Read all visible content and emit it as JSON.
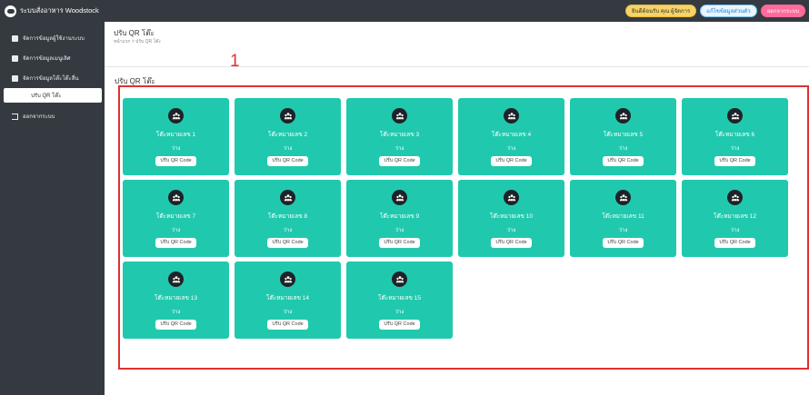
{
  "brand": {
    "name": "ระบบสั่งอาหาร Woodstock"
  },
  "top_actions": [
    {
      "label": "ยินดีต้อนรับ คุณ ผู้จัดการ",
      "style": "green"
    },
    {
      "label": "แก้ไขข้อมูลส่วนตัว",
      "style": "blue"
    },
    {
      "label": "ออกจากระบบ",
      "style": "pink"
    }
  ],
  "sidebar": {
    "items": [
      {
        "label": "จัดการข้อมูลผู้ใช้งานระบบ",
        "icon": "users-icon"
      },
      {
        "label": "จัดการข้อมูลเมนูเลิศ",
        "icon": "document-icon"
      },
      {
        "label": "จัดการข้อมูลโต๊ะโต๊ะลื่น",
        "icon": "table-icon"
      }
    ],
    "sub_item": "ปรับ QR โต๊ะ",
    "logout": "ออกจากระบบ"
  },
  "header": {
    "title": "ปรับ QR โต๊ะ",
    "breadcrumb": "หน้าแรก > ปรับ QR โต๊ะ"
  },
  "annotation": "1",
  "section_title": "ปรับ QR โต๊ะ",
  "tables": [
    {
      "name": "โต๊ะหมายเลข 1",
      "status": "ว่าง",
      "button": "ปรับ QR Code"
    },
    {
      "name": "โต๊ะหมายเลข 2",
      "status": "ว่าง",
      "button": "ปรับ QR Code"
    },
    {
      "name": "โต๊ะหมายเลข 3",
      "status": "ว่าง",
      "button": "ปรับ QR Code"
    },
    {
      "name": "โต๊ะหมายเลข 4",
      "status": "ว่าง",
      "button": "ปรับ QR Code"
    },
    {
      "name": "โต๊ะหมายเลข 5",
      "status": "ว่าง",
      "button": "ปรับ QR Code"
    },
    {
      "name": "โต๊ะหมายเลข 6",
      "status": "ว่าง",
      "button": "ปรับ QR Code"
    },
    {
      "name": "โต๊ะหมายเลข 7",
      "status": "ว่าง",
      "button": "ปรับ QR Code"
    },
    {
      "name": "โต๊ะหมายเลข 8",
      "status": "ว่าง",
      "button": "ปรับ QR Code"
    },
    {
      "name": "โต๊ะหมายเลข 9",
      "status": "ว่าง",
      "button": "ปรับ QR Code"
    },
    {
      "name": "โต๊ะหมายเลข 10",
      "status": "ว่าง",
      "button": "ปรับ QR Code"
    },
    {
      "name": "โต๊ะหมายเลข 11",
      "status": "ว่าง",
      "button": "ปรับ QR Code"
    },
    {
      "name": "โต๊ะหมายเลข 12",
      "status": "ว่าง",
      "button": "ปรับ QR Code"
    },
    {
      "name": "โต๊ะหมายเลข 13",
      "status": "ว่าง",
      "button": "ปรับ QR Code"
    },
    {
      "name": "โต๊ะหมายเลข 14",
      "status": "ว่าง",
      "button": "ปรับ QR Code"
    },
    {
      "name": "โต๊ะหมายเลข 15",
      "status": "ว่าง",
      "button": "ปรับ QR Code"
    }
  ],
  "colors": {
    "sidebar": "#343a40",
    "card": "#20c9ad",
    "highlight": "#e03131"
  }
}
